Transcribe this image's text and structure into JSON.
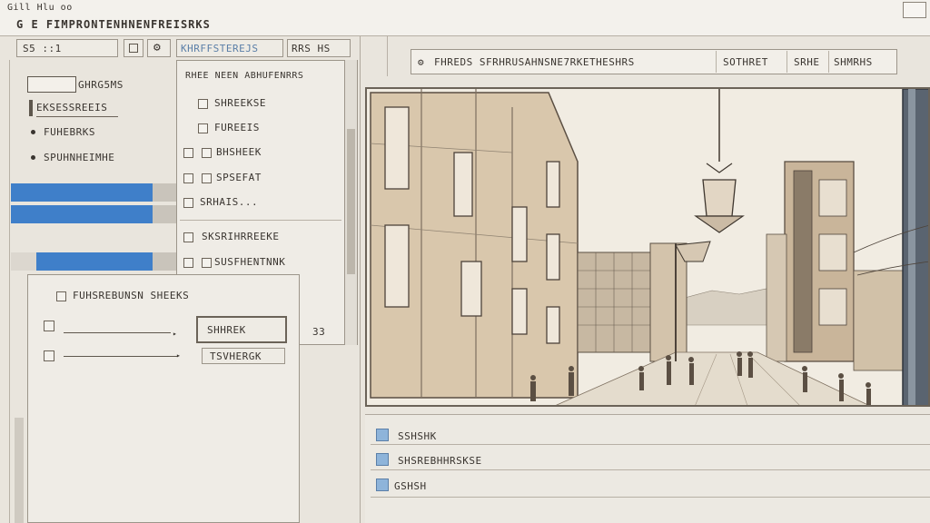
{
  "window": {
    "title": "Gill Hlu oo"
  },
  "toolbar": {
    "title": "G E FIMPRONTENHNENFREISRKS",
    "btn1": "S5 ::1",
    "btn2": "",
    "btn3": "KHRFFSTEREJS",
    "btn4": "RRS HS"
  },
  "left_panel": {
    "items": [
      {
        "label": "GHRG5MS"
      },
      {
        "label": "EKSESSREEIS"
      },
      {
        "label": "FUHEBRKS"
      },
      {
        "label": "SPUHNHEIMHE"
      }
    ]
  },
  "dropdown": {
    "items": [
      {
        "label": "RHEE NEEN ABHUFENRRS"
      },
      {
        "label": "SHREEKSE"
      },
      {
        "label": "FUREEIS"
      },
      {
        "label": "BHSHEEK"
      },
      {
        "label": "SPSEFAT"
      },
      {
        "label": "SRHAIS..."
      },
      {
        "label": "SKSRIHRREEKE"
      },
      {
        "label": "SUSFHENTNNK"
      }
    ]
  },
  "dialog": {
    "title": "FUHSREBUNSN SHEEKS",
    "button1": "SHHREK",
    "button2": "TSVHERGK",
    "side_value": "33"
  },
  "top_strip": {
    "text": "FHREDS SFRHRUSAHNSNE7RKETHESHRS",
    "btn1": "SOTHRET",
    "btn2": "SRHE",
    "btn3": "SHMRHS"
  },
  "bottom_list": {
    "items": [
      {
        "label": "SSHSHK"
      },
      {
        "label": "SHSREBHHRSKSE"
      },
      {
        "label": "GSHSH"
      }
    ]
  }
}
